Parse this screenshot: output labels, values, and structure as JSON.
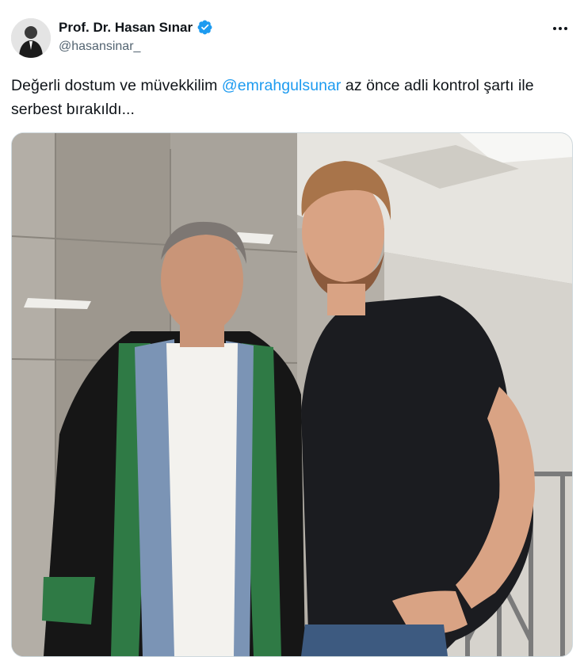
{
  "author": {
    "display_name": "Prof. Dr. Hasan Sınar",
    "handle": "@hasansinar_",
    "verified_icon": "verified-badge-icon"
  },
  "tweet": {
    "text_before": "Değerli dostum ve müvekkilim ",
    "mention": "@emrahgulsunar",
    "text_after": " az önce adli kontrol şartı ile serbest bırakıldı...",
    "media_description_icon": "photo"
  },
  "colors": {
    "accent": "#1d9bf0",
    "text": "#0f1419",
    "secondary": "#536471"
  }
}
